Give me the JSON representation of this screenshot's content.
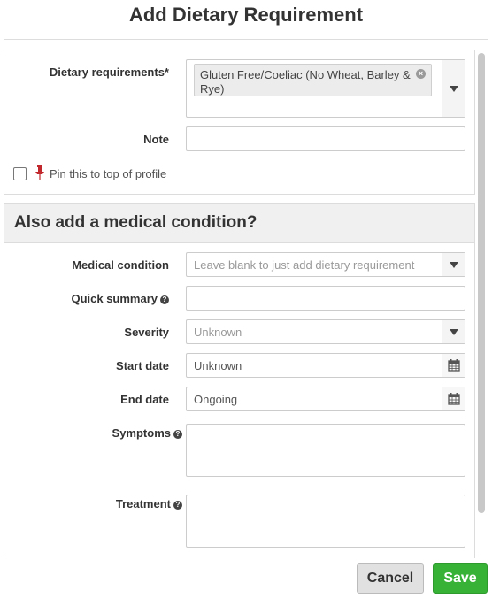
{
  "dialog": {
    "title": "Add Dietary Requirement"
  },
  "dietary": {
    "label": "Dietary requirements*",
    "selected_tag": "Gluten Free/Coeliac (No Wheat, Barley & Rye)",
    "tag_remove_glyph": "×",
    "dropdown_icon": "caret-down-icon"
  },
  "note": {
    "label": "Note",
    "value": ""
  },
  "pin": {
    "label": "Pin this to top of profile",
    "checked": false,
    "icon": "pin-icon",
    "icon_color": "#c0282d"
  },
  "medical": {
    "heading": "Also add a medical condition?",
    "condition": {
      "label": "Medical condition",
      "placeholder": "Leave blank to just add dietary requirement"
    },
    "quick_summary": {
      "label": "Quick summary",
      "value": "",
      "help_icon": "question-circle-icon"
    },
    "severity": {
      "label": "Severity",
      "value": "Unknown"
    },
    "start_date": {
      "label": "Start date",
      "value": "Unknown",
      "icon": "calendar-icon"
    },
    "end_date": {
      "label": "End date",
      "value": "Ongoing",
      "icon": "calendar-icon"
    },
    "symptoms": {
      "label": "Symptoms",
      "value": ""
    },
    "treatment": {
      "label": "Treatment",
      "value": ""
    },
    "help_glyph": "?"
  },
  "footer": {
    "cancel_label": "Cancel",
    "save_label": "Save",
    "save_color": "#37b236"
  }
}
